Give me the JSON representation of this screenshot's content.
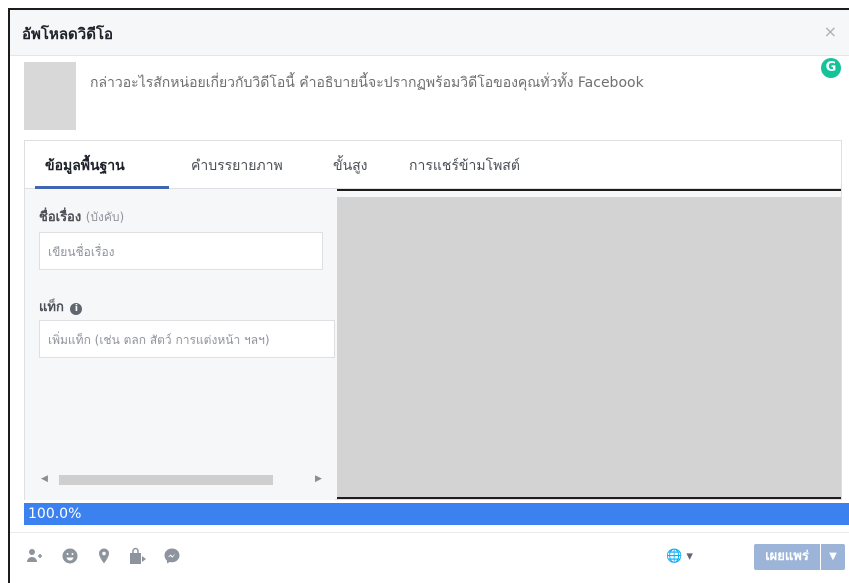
{
  "dialog": {
    "title": "อัพโหลดวิดีโอ",
    "close": "×"
  },
  "composer": {
    "placeholder": "กล่าวอะไรสักหน่อยเกี่ยวกับวิดีโอนี้ คำอธิบายนี้จะปรากฏพร้อมวิดีโอของคุณทั่วทั้ง Facebook",
    "badge": "G"
  },
  "tabs": [
    {
      "label": "ข้อมูลพื้นฐาน"
    },
    {
      "label": "คำบรรยายภาพ"
    },
    {
      "label": "ขั้นสูง"
    },
    {
      "label": "การแชร์ข้ามโพสต์"
    }
  ],
  "form": {
    "title_label": "ชื่อเรื่อง",
    "title_required": "(บังคับ)",
    "title_placeholder": "เขียนชื่อเรื่อง",
    "tag_label": "แท็ก",
    "tag_placeholder": "เพิ่มแท็ก (เช่น ตลก สัตว์ การแต่งหน้า ฯลฯ)"
  },
  "upload": {
    "progress_text": "100.0%",
    "progress": 1.0
  },
  "footer": {
    "icons": [
      "tag-people-icon",
      "feeling-icon",
      "location-icon",
      "shopping-bag-icon",
      "messenger-icon"
    ],
    "audience_icon": "globe-icon",
    "publish_label": "เผยแพร่"
  },
  "colors": {
    "progress": "#3b82f0",
    "publish": "#9cb4d8",
    "tab_active": "#4267b2"
  }
}
